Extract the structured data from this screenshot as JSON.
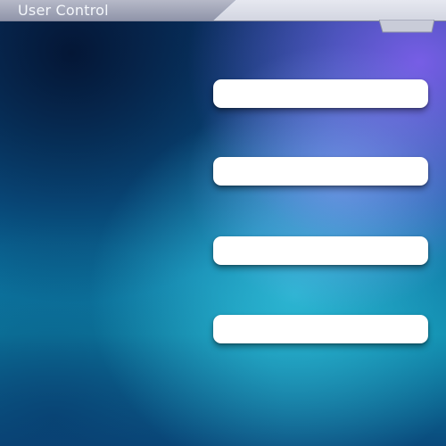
{
  "window": {
    "title": "User Control"
  },
  "fields": [
    {
      "value": ""
    },
    {
      "value": ""
    },
    {
      "value": ""
    },
    {
      "value": ""
    }
  ],
  "colors": {
    "title_bar_light": "#d9dce6",
    "title_bar_dark": "#9ea3b8",
    "field_background": "#ffffff"
  },
  "icons": {
    "title_tab": "tab-notch-icon"
  }
}
